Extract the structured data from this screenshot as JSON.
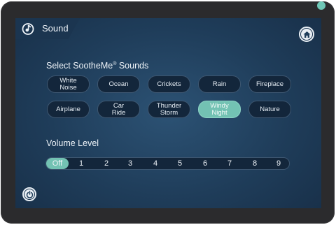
{
  "header": {
    "title": "Sound",
    "icon": "sound-note-icon"
  },
  "home": {
    "icon": "home-icon"
  },
  "sounds": {
    "title_main": "Select SootheMe",
    "title_mark": "®",
    "title_rest": " Sounds",
    "selected": "Windy Night",
    "items": [
      "White\nNoise",
      "Ocean",
      "Crickets",
      "Rain",
      "Fireplace",
      "Airplane",
      "Car\nRide",
      "Thunder\nStorm",
      "Windy\nNight",
      "Nature"
    ]
  },
  "volume": {
    "title": "Volume Level",
    "selected": "Off",
    "levels": [
      "Off",
      "1",
      "2",
      "3",
      "4",
      "5",
      "6",
      "7",
      "8",
      "9"
    ]
  },
  "power": {
    "icon": "power-icon"
  },
  "colors": {
    "accent": "#73c2b3",
    "led": "#6fc7b6",
    "screen_bg": "#1f3d5a",
    "bezel": "#2b2b2d"
  }
}
